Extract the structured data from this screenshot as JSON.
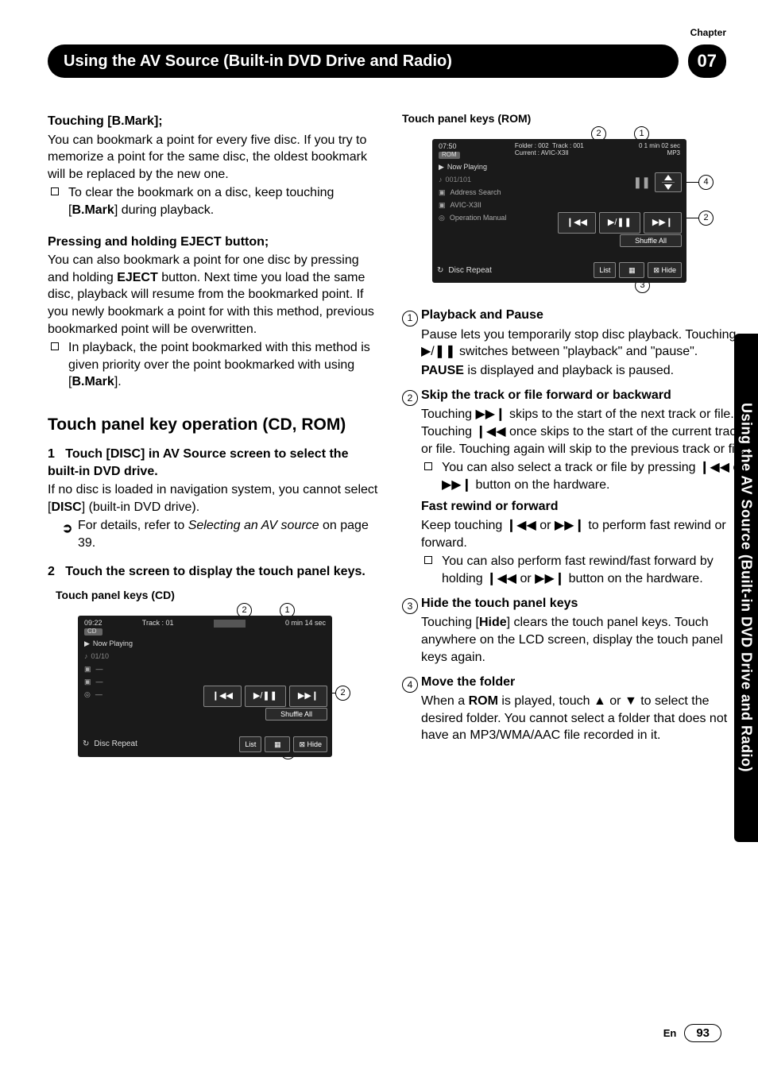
{
  "chapter_label": "Chapter",
  "chapter_number": "07",
  "main_title": "Using the AV Source (Built-in DVD Drive and Radio)",
  "side_tab": "Using the AV Source (Built-in DVD Drive and Radio)",
  "left": {
    "h_bmark_pre": "Touching [",
    "h_bmark_mid": "B.Mark",
    "h_bmark_post": "];",
    "p_bmark": "You can bookmark a point for every five disc. If you try to memorize a point for the same disc, the oldest bookmark will be replaced by the new one.",
    "li_bmark_a": "To clear the bookmark on a disc, keep touching [",
    "li_bmark_b": "B.Mark",
    "li_bmark_c": "] during playback.",
    "h_eject_pre": "Pressing and holding ",
    "h_eject_mid": "EJECT",
    "h_eject_post": " button;",
    "p_eject_a": "You can also bookmark a point for one disc by pressing and holding ",
    "p_eject_b": "EJECT",
    "p_eject_c": " button. Next time you load the same disc, playback will resume from the bookmarked point. If you newly bookmark a point for with this method, previous bookmarked point will be overwritten.",
    "li_eject_a": "In playback, the point bookmarked with this method is given priority over the point bookmarked with using [",
    "li_eject_b": "B.Mark",
    "li_eject_c": "].",
    "h2": "Touch panel key operation (CD, ROM)",
    "step1_num": "1",
    "step1_txt": "Touch [DISC] in AV Source screen to select the built-in DVD drive.",
    "step1_body_a": "If no disc is loaded in navigation system, you cannot select [",
    "step1_body_b": "DISC",
    "step1_body_c": "] (built-in DVD drive).",
    "step1_xref_a": "For details, refer to ",
    "step1_xref_i": "Selecting an AV source",
    "step1_xref_b": " on page 39.",
    "step2_num": "2",
    "step2_txt": "Touch the screen to display the touch panel keys.",
    "cap_cd": "Touch panel keys (CD)",
    "dev_cd": {
      "time": "09:22",
      "track": "Track : 01",
      "dur": "0 min   14 sec",
      "now": "Now Playing",
      "pos": "01/10",
      "repeat": "Disc Repeat",
      "list": "List",
      "shuffle": "Shuffle All",
      "hide": "⊠ Hide"
    }
  },
  "right": {
    "cap_rom": "Touch panel keys (ROM)",
    "dev_rom": {
      "time": "07:50",
      "folder": "Folder : 002",
      "track": "Track : 001",
      "current": "Current : AVIC-X3II",
      "dur": "0   1 min   02 sec",
      "fmt": "MP3",
      "now": "Now Playing",
      "pos": "001/101",
      "addr": "Address Search",
      "avic": "AVIC-X3II",
      "op": "Operation Manual",
      "repeat": "Disc Repeat",
      "list": "List",
      "shuffle": "Shuffle All",
      "hide": "⊠ Hide"
    },
    "items": {
      "i1_t": "Playback and Pause",
      "i1_a": "Pause lets you temporarily stop disc playback. Touching ▶/❚❚ switches between \"playback\" and \"pause\".",
      "i1_b": "PAUSE",
      "i1_c": " is displayed and playback is paused.",
      "i2_t": "Skip the track or file forward or backward",
      "i2_a": "Touching ▶▶❙ skips to the start of the next track or file. Touching ❙◀◀ once skips to the start of the current track or file. Touching again will skip to the previous track or file.",
      "i2_li": "You can also select a track or file by pressing ❙◀◀ or ▶▶❙ button on the hardware.",
      "i2_ft": "Fast rewind or forward",
      "i2_fb": "Keep touching ❙◀◀ or ▶▶❙ to perform fast rewind or forward.",
      "i2_li2": "You can also perform fast rewind/fast forward by holding ❙◀◀ or ▶▶❙ button on the hardware.",
      "i3_t": "Hide the touch panel keys",
      "i3_a1": "Touching [",
      "i3_a2": "Hide",
      "i3_a3": "] clears the touch panel keys. Touch anywhere on the LCD screen, display the touch panel keys again.",
      "i4_t": "Move the folder",
      "i4_a1": "When a ",
      "i4_a2": "ROM",
      "i4_a3": " is played, touch ▲ or ▼ to select the desired folder. You cannot select a folder that does not have an MP3/WMA/AAC file recorded in it."
    }
  },
  "footer": {
    "lang": "En",
    "page": "93"
  }
}
